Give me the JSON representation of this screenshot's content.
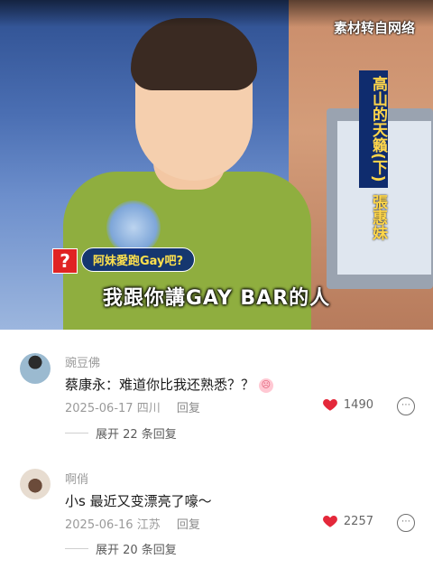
{
  "video": {
    "watermark": "素材转自网络",
    "show_title": "高山的天籟(下)",
    "guest_name": "張惠妹",
    "question_mark": "?",
    "question_label": "阿妹愛跑Gay吧?",
    "subtitle": "我跟你講GAY BAR的人"
  },
  "comments": [
    {
      "username": "豌豆佛",
      "text": "蔡康永：难道你比我还熟悉？？",
      "date": "2025-06-17",
      "location": "四川",
      "reply_label": "回复",
      "likes": "1490",
      "expand_label": "展开 22 条回复"
    },
    {
      "username": "啊俏",
      "text": "小s 最近又变漂亮了嚎～",
      "date": "2025-06-16",
      "location": "江苏",
      "reply_label": "回复",
      "likes": "2257",
      "expand_label": "展开 20 条回复"
    }
  ],
  "colors": {
    "heart": "#e4283a",
    "title_bg": "#0f2c6e",
    "title_text": "#ffd64a"
  },
  "icons": {
    "like": "heart-icon",
    "more": "more-options-icon",
    "emoji": "crying-emoji-icon"
  }
}
